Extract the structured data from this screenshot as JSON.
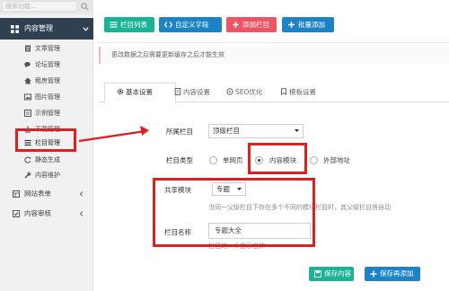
{
  "sidebar": {
    "search_placeholder": "搜索功能...",
    "group_label": "内容管理",
    "items": [
      {
        "label": "文章管理",
        "icon": "file-text-icon"
      },
      {
        "label": "论坛管理",
        "icon": "comments-icon"
      },
      {
        "label": "租房管理",
        "icon": "home-icon"
      },
      {
        "label": "图片管理",
        "icon": "image-icon"
      },
      {
        "label": "示例管理",
        "icon": "list-icon"
      },
      {
        "label": "下载管理",
        "icon": "download-icon"
      },
      {
        "label": "栏目管理",
        "icon": "bars-icon"
      },
      {
        "label": "静态生成",
        "icon": "refresh-icon"
      },
      {
        "label": "内容维护",
        "icon": "wrench-icon"
      }
    ],
    "top_items": [
      {
        "label": "网站表单",
        "icon": "form-icon"
      },
      {
        "label": "内容审核",
        "icon": "check-icon"
      }
    ]
  },
  "toolbar": {
    "buttons": [
      {
        "label": "栏目列表",
        "color": "#1ab394"
      },
      {
        "label": "自定义字段",
        "color": "#1c84c6"
      },
      {
        "label": "添加栏目",
        "color": "#ed5565"
      },
      {
        "label": "批量添加",
        "color": "#1c84c6"
      }
    ]
  },
  "notice": "更改数据之后需要更新缓存之后才能生效",
  "tabs": [
    {
      "label": "基本设置",
      "icon": "gear-icon",
      "active": true
    },
    {
      "label": "内容设置",
      "icon": "file-icon",
      "active": false
    },
    {
      "label": "SEO优化",
      "icon": "tag-icon",
      "active": false
    },
    {
      "label": "模板设置",
      "icon": "template-icon",
      "active": false
    }
  ],
  "form": {
    "parent": {
      "label": "所属栏目",
      "value": "顶级栏目"
    },
    "type": {
      "label": "栏目类型",
      "options": [
        {
          "label": "单网页",
          "selected": false
        },
        {
          "label": "内容模块",
          "selected": true
        },
        {
          "label": "外部地址",
          "selected": false
        }
      ]
    },
    "shared": {
      "label": "共享模块",
      "value": "专题",
      "help": "当同一父级栏目下存在多个不同的模块栏目时，其父级栏目将自动"
    },
    "name": {
      "label": "栏目名称",
      "value": "专题大全",
      "help": "栏目的一个显示名称"
    }
  },
  "actions": [
    {
      "label": "保存内容",
      "color": "#1ab394"
    },
    {
      "label": "保存再添加",
      "color": "#1c84c6"
    }
  ],
  "colors": {
    "highlight": "#e02020",
    "sidebar_active": "#2f4050"
  }
}
